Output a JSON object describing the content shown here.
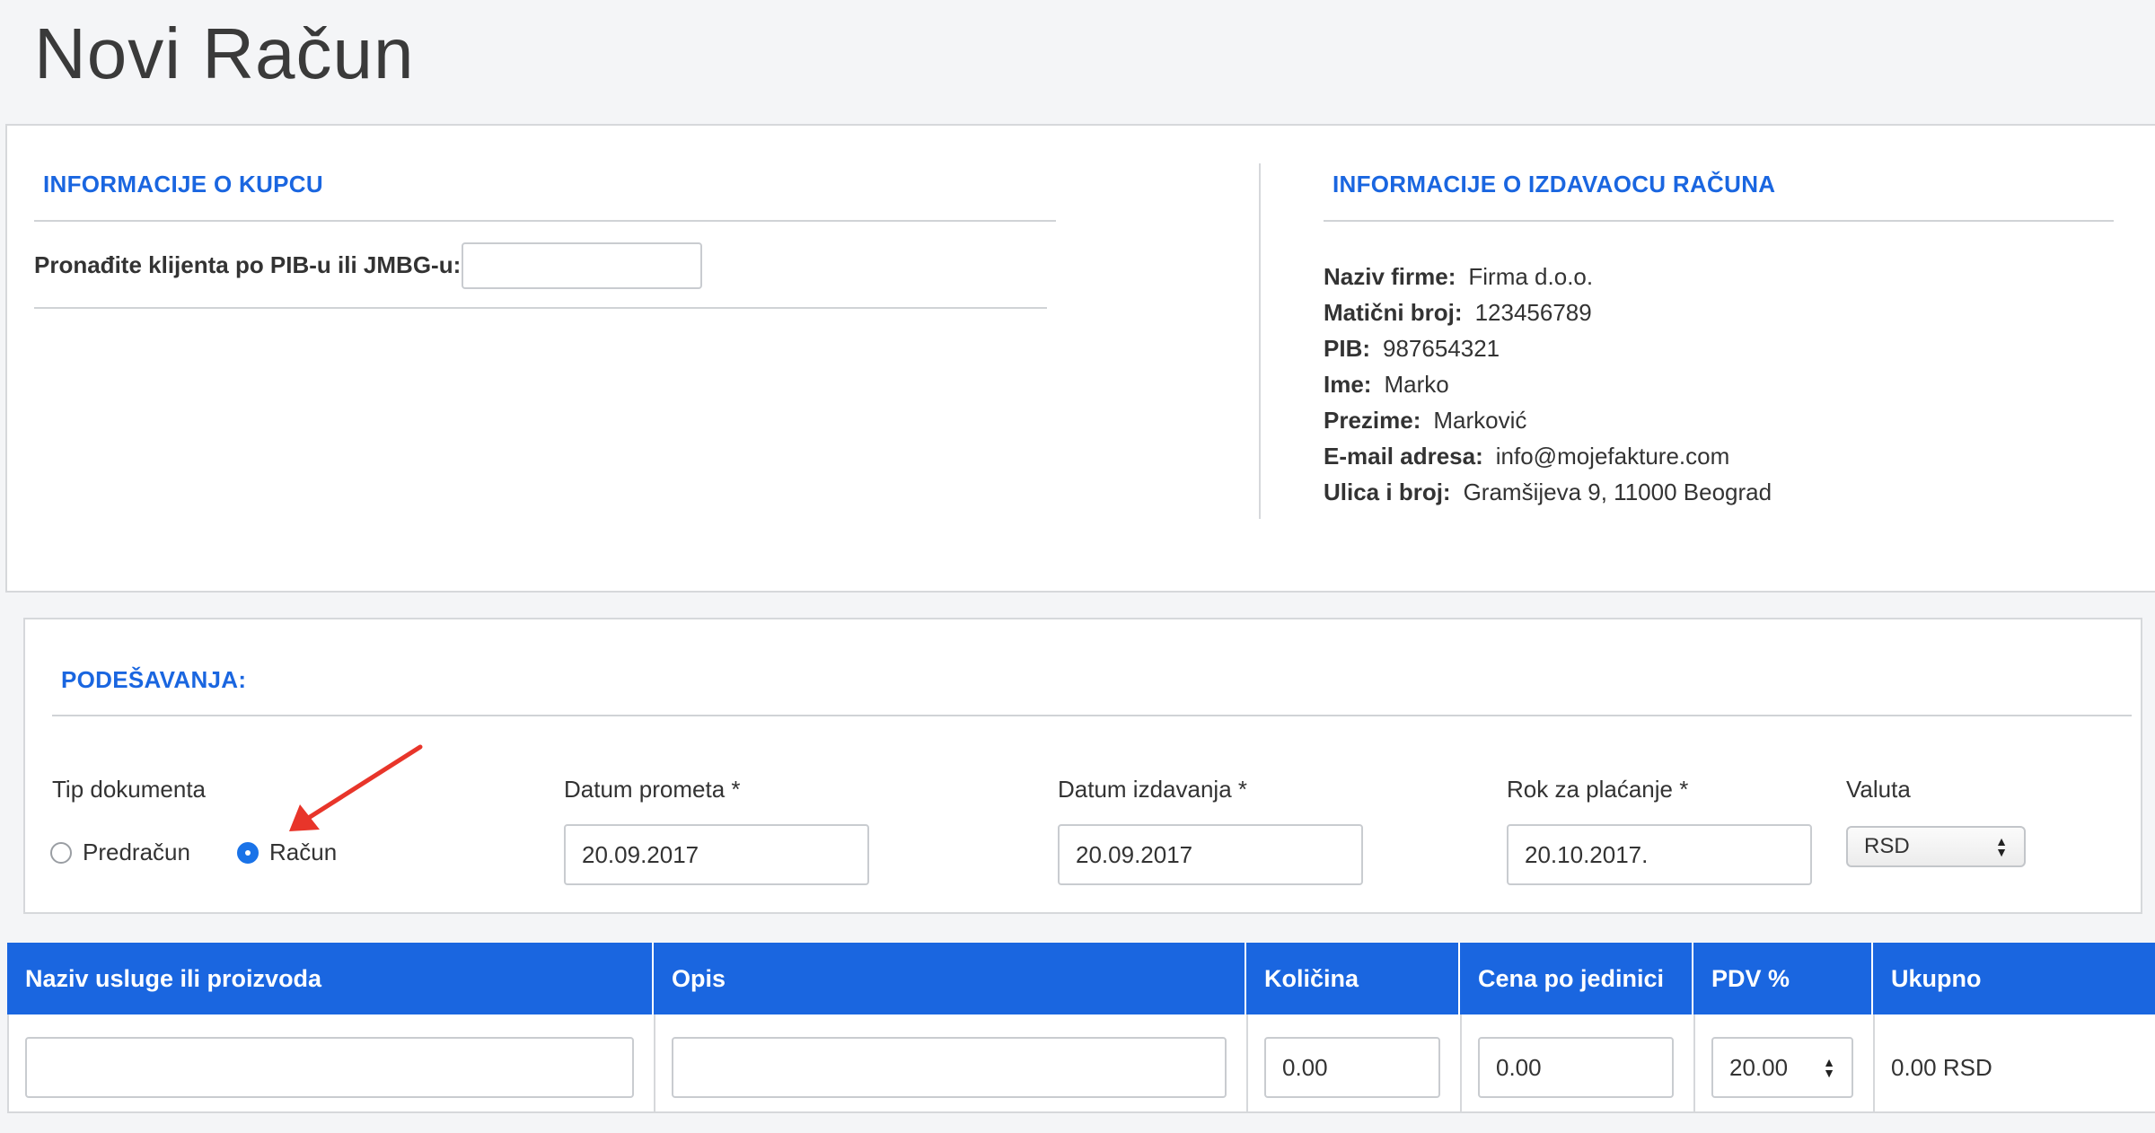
{
  "page": {
    "title": "Novi Račun"
  },
  "customer": {
    "section_title": "INFORMACIJE O KUPCU",
    "search_label": "Pronađite klijenta po PIB-u ili JMBG-u:",
    "search_value": ""
  },
  "issuer": {
    "section_title": "INFORMACIJE O IZDAVAOCU RAČUNA",
    "rows": [
      {
        "key": "Naziv firme:",
        "value": "Firma d.o.o."
      },
      {
        "key": "Matični broj:",
        "value": "123456789"
      },
      {
        "key": "PIB:",
        "value": "987654321"
      },
      {
        "key": "Ime:",
        "value": "Marko"
      },
      {
        "key": "Prezime:",
        "value": "Marković"
      },
      {
        "key": "E-mail adresa:",
        "value": "info@mojefakture.com"
      },
      {
        "key": "Ulica i broj:",
        "value": "Gramšijeva 9, 11000 Beograd"
      }
    ]
  },
  "settings": {
    "section_title": "PODEŠAVANJA:",
    "doc_type_label": "Tip dokumenta",
    "doc_types": [
      {
        "label": "Predračun",
        "checked": false
      },
      {
        "label": "Račun",
        "checked": true
      }
    ],
    "turnover_date_label": "Datum prometa *",
    "turnover_date": "20.09.2017",
    "issue_date_label": "Datum izdavanja *",
    "issue_date": "20.09.2017",
    "due_date_label": "Rok za plaćanje *",
    "due_date": "20.10.2017.",
    "currency_label": "Valuta",
    "currency": "RSD"
  },
  "table": {
    "headers": [
      "Naziv usluge ili proizvoda",
      "Opis",
      "Količina",
      "Cena po jedinici",
      "PDV %",
      "Ukupno"
    ],
    "row": {
      "name": "",
      "description": "",
      "quantity": "0.00",
      "unit_price": "0.00",
      "vat": "20.00",
      "total": "0.00 RSD"
    }
  },
  "colors": {
    "accent": "#1a66e0",
    "annotation_arrow": "#e8352a"
  }
}
